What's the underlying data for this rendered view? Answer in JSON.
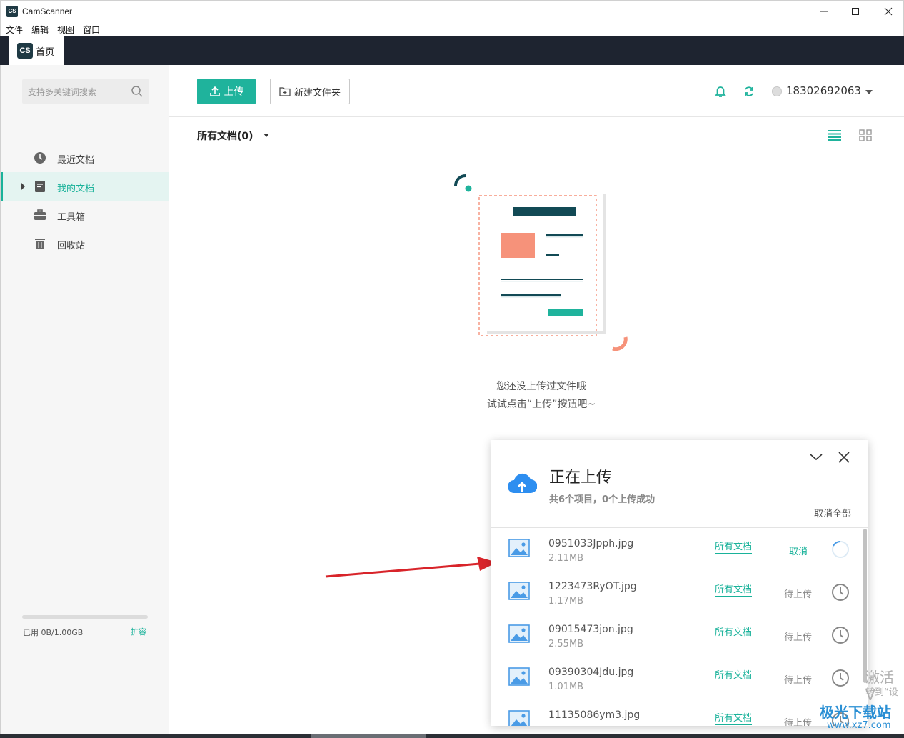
{
  "window": {
    "icon_text": "CS",
    "title": "CamScanner"
  },
  "menu": [
    "文件",
    "编辑",
    "视图",
    "窗口"
  ],
  "tab": {
    "logo_text": "CS",
    "label": "首页"
  },
  "sidebar": {
    "search_placeholder": "支持多关键词搜索",
    "items": [
      {
        "label": "最近文档",
        "icon": "clock-icon"
      },
      {
        "label": "我的文档",
        "icon": "document-icon",
        "active": true
      },
      {
        "label": "工具箱",
        "icon": "toolbox-icon"
      },
      {
        "label": "回收站",
        "icon": "trash-icon"
      }
    ],
    "storage": {
      "used_text": "已用 0B/1.00GB",
      "used_fraction": 0,
      "expand_label": "扩容"
    }
  },
  "toolbar": {
    "upload_label": "上传",
    "new_folder_label": "新建文件夹",
    "user_phone": "18302692063"
  },
  "documents": {
    "header": "所有文档(0)",
    "empty_line1": "您还没上传过文件哦",
    "empty_line2": "试试点击“上传”按钮吧~"
  },
  "upload_panel": {
    "title": "正在上传",
    "subtitle": "共6个项目，0个上传成功",
    "cancel_all": "取消全部",
    "files": [
      {
        "name": "0951033Jpph.jpg",
        "size": "2.11MB",
        "dest": "所有文档",
        "status": "取消",
        "state": "uploading"
      },
      {
        "name": "1223473RyOT.jpg",
        "size": "1.17MB",
        "dest": "所有文档",
        "status": "待上传",
        "state": "pending"
      },
      {
        "name": "09015473jon.jpg",
        "size": "2.55MB",
        "dest": "所有文档",
        "status": "待上传",
        "state": "pending"
      },
      {
        "name": "09390304Jdu.jpg",
        "size": "1.01MB",
        "dest": "所有文档",
        "status": "待上传",
        "state": "pending"
      },
      {
        "name": "11135086ym3.jpg",
        "size": "",
        "dest": "所有文档",
        "status": "待上传",
        "state": "pending"
      }
    ]
  },
  "watermark": {
    "activate_line1": "激活 V",
    "activate_line2": "转到“设",
    "site_name": "极光下载站",
    "site_url": "www.xz7.com"
  },
  "colors": {
    "accent": "#1fb39c",
    "dark_bar": "#1e2430",
    "cloud_blue": "#2d8ef0",
    "illus_salmon": "#f6927a",
    "illus_dark": "#124a55"
  }
}
